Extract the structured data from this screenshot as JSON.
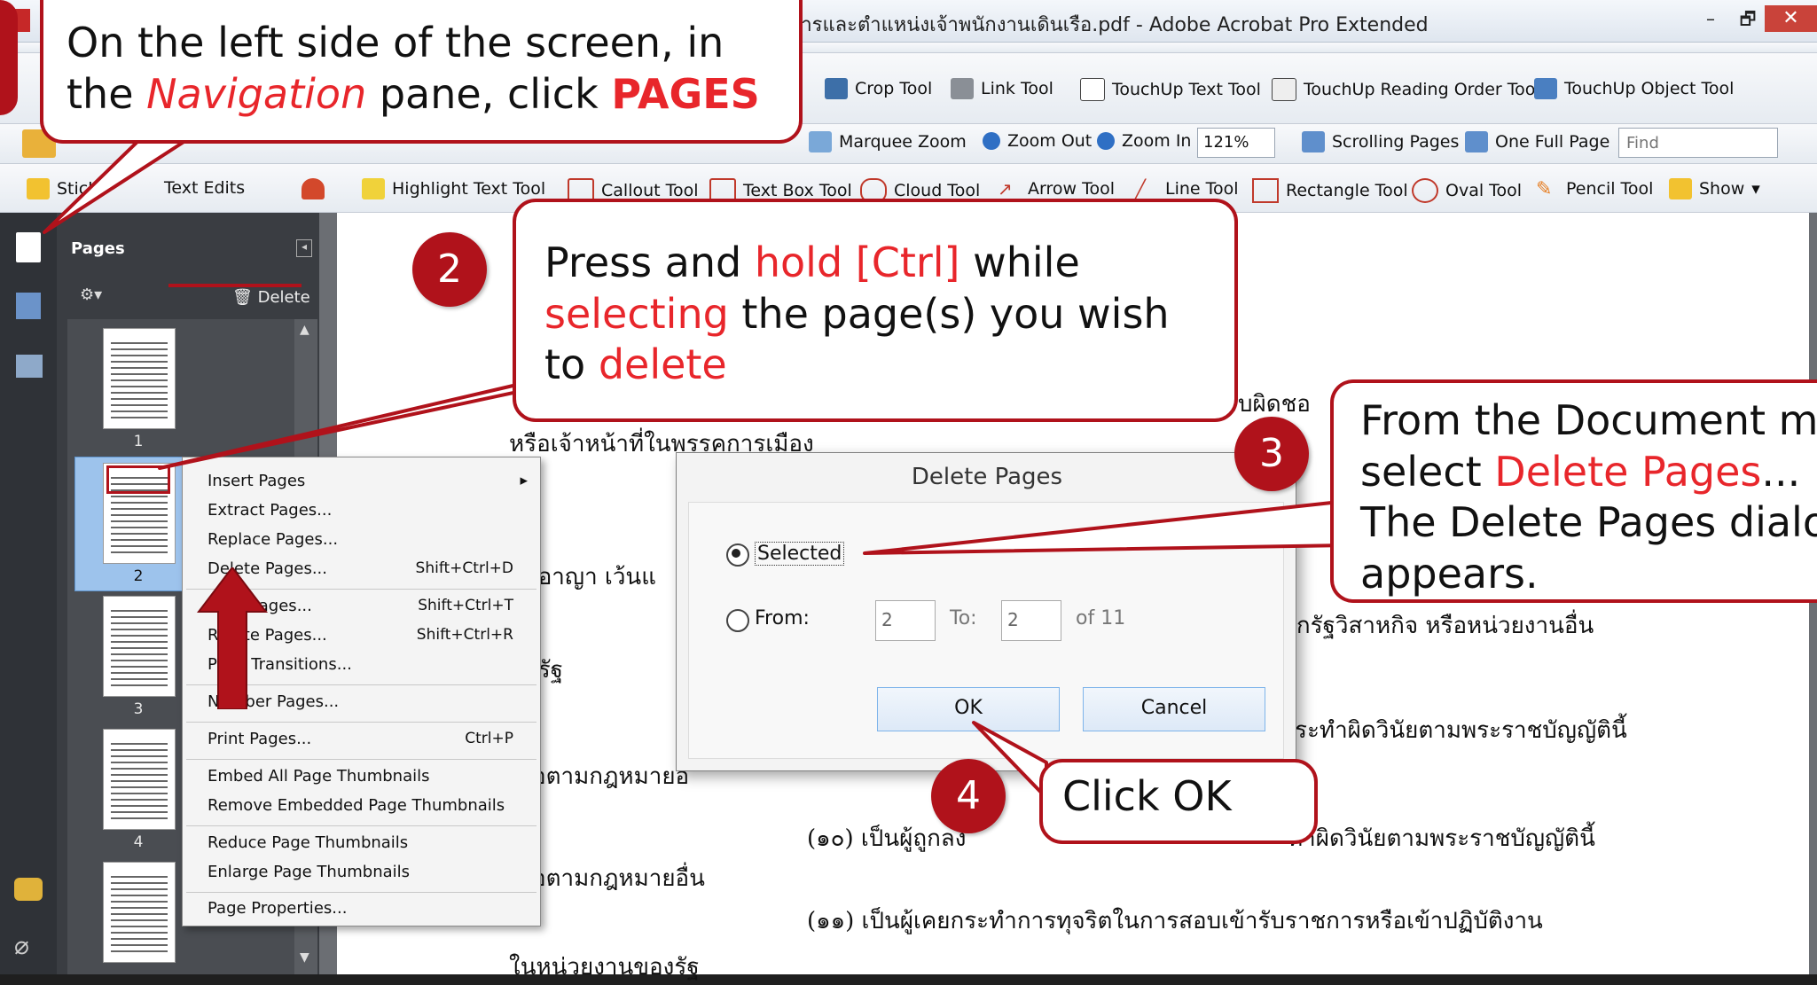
{
  "window": {
    "title": "การและตำแหน่งเจ้าพนักงานเดินเรือ.pdf - Adobe Acrobat Pro Extended",
    "minimize": "–",
    "restore": "🗗",
    "close": "✕"
  },
  "toolbar1": {
    "items": [
      {
        "label": "Crop Tool",
        "icon": "crop-icon"
      },
      {
        "label": "Link Tool",
        "icon": "link-icon"
      },
      {
        "label": "TouchUp Text Tool",
        "icon": "touchup-text-icon"
      },
      {
        "label": "TouchUp Reading Order Tool",
        "icon": "reading-order-icon"
      },
      {
        "label": "TouchUp Object Tool",
        "icon": "touchup-object-icon"
      }
    ]
  },
  "toolbar2": {
    "marquee_zoom": "Marquee Zoom",
    "zoom_out": "Zoom Out",
    "zoom_in": "Zoom In",
    "zoom_value": "121%",
    "scrolling_pages": "Scrolling Pages",
    "one_full_page": "One Full Page",
    "find_placeholder": "Find"
  },
  "toolbar3": {
    "items": [
      "Sticky",
      "Text Edits",
      "Highlight Text Tool",
      "Callout Tool",
      "Text Box Tool",
      "Cloud Tool",
      "Arrow Tool",
      "Line Tool",
      "Rectangle Tool",
      "Oval Tool",
      "Pencil Tool",
      "Show"
    ]
  },
  "nav": {
    "panel_title": "Pages",
    "delete_label": "Delete",
    "thumb_numbers": [
      "1",
      "2",
      "3",
      "4"
    ]
  },
  "document": {
    "lines": [
      "รับผิดชอ",
      "หรือเจ้าหน้าที่ในพรรคการเมือง",
      "งอาญา เว้นแ",
      "จากรัฐวิสาหกิจ หรือหน่วยงานอื่น",
      "งรัฐ",
      "ระทำผิดวินัยตามพระราชบัญญัตินี้",
      "อตามกฎหมายอื่",
      "(๑๐) เป็นผู้ถูกลง",
      "ทำผิดวินัยตามพระราชบัญญัตินี้",
      "อตามกฎหมายอื่น",
      "(๑๑) เป็นผู้เคยกระทำการทุจริตในการสอบเข้ารับราชการหรือเข้าปฏิบัติงาน",
      "ในหน่วยงานของรัฐ"
    ]
  },
  "context_menu": {
    "items": [
      {
        "label": "Insert Pages",
        "shortcut": "",
        "submenu": true
      },
      {
        "label": "Extract Pages...",
        "shortcut": ""
      },
      {
        "label": "Replace Pages...",
        "shortcut": ""
      },
      {
        "label": "Delete Pages...",
        "shortcut": "Shift+Ctrl+D"
      },
      {
        "label": "Crop Pages...",
        "shortcut": "Shift+Ctrl+T"
      },
      {
        "label": "Rotate Pages...",
        "shortcut": "Shift+Ctrl+R"
      },
      {
        "label": "Page Transitions...",
        "shortcut": ""
      },
      {
        "label": "Number Pages...",
        "shortcut": ""
      },
      {
        "label": "Print Pages...",
        "shortcut": "Ctrl+P"
      },
      {
        "label": "Embed All Page Thumbnails",
        "shortcut": ""
      },
      {
        "label": "Remove Embedded Page Thumbnails",
        "shortcut": ""
      },
      {
        "label": "Reduce Page Thumbnails",
        "shortcut": ""
      },
      {
        "label": "Enlarge Page Thumbnails",
        "shortcut": ""
      },
      {
        "label": "Page Properties...",
        "shortcut": ""
      }
    ]
  },
  "dialog": {
    "title": "Delete Pages",
    "selected_label": "Selected",
    "from_label": "From:",
    "from_value": "2",
    "to_label": "To:",
    "to_value": "2",
    "of_label": "of 11",
    "ok": "OK",
    "cancel": "Cancel"
  },
  "callouts": {
    "step1": {
      "pre": "On the left side of the screen, in the ",
      "em": "Navigation",
      "post": " pane, click ",
      "bold": "PAGES"
    },
    "step2": {
      "n": "2",
      "t1": "Press and ",
      "r1": "hold [Ctrl]",
      "t2": " while ",
      "r2": "selecting",
      "t3": " the page(s) you wish to ",
      "r3": "delete"
    },
    "step3": {
      "n": "3",
      "t1": "From the Document m",
      "t2": "select ",
      "r1": "Delete Pages",
      "t3": "...",
      "t4": "The Delete Pages dialo",
      "t5": "appears."
    },
    "step4": {
      "n": "4",
      "text": "Click OK"
    }
  },
  "colors": {
    "callout_border": "#b0121b",
    "highlight_text": "#e8262b",
    "dialog_button_border": "#7eb4ea"
  }
}
